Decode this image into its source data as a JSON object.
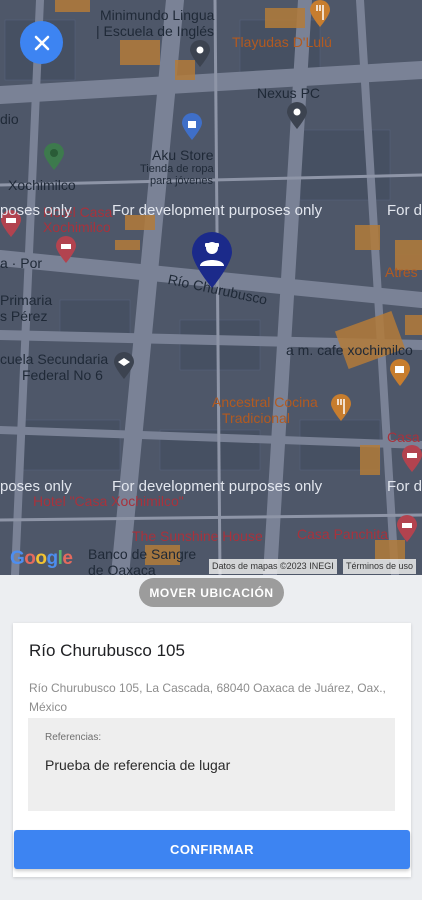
{
  "map": {
    "labels": {
      "minimundo": "Minimundo Lingua",
      "escuela_ingles": "| Escuela de Inglés",
      "tlayudas": "Tlayudas D'Lulú",
      "nexus": "Nexus PC",
      "dio": "dio",
      "aku": "Aku Store",
      "aku_sub_1": "Tienda de ropa",
      "aku_sub_2": "para jóvenes",
      "xochimilco": "Xochimilco",
      "hotel_casa_1": "Hotel Casa",
      "xochimilco_2": "Xochimilco",
      "rio_churubusco": "Río Churubusco",
      "atres": "Atres",
      "primaria": "Primaria",
      "s_perez": "s Pérez",
      "a_por": "a · Por",
      "secundaria_1": "cuela Secundaria",
      "secundaria_2": "Federal No 6",
      "cafe": "a m. cafe xochimilco",
      "ancestral_1": "Ancestral Cocina",
      "ancestral_2": "Tradicional",
      "casa": "Casa",
      "hotel_casa_2": "Hotel \"Casa Xochimilco\"",
      "sunshine": "The Sunshine House",
      "panchita": "Casa Panchita",
      "banco_1": "Banco de Sangre",
      "banco_2": "de Oaxaca"
    },
    "dev_text": {
      "center": "For development purposes only",
      "left": "poses only",
      "right": "For d"
    },
    "google_letters": [
      "G",
      "o",
      "o",
      "g",
      "l",
      "e"
    ],
    "attribution": {
      "data": "Datos de mapas ©2023 INEGI",
      "terms": "Términos de uso"
    },
    "close_icon": "close-icon",
    "pin_icon": "user-location-pin-icon",
    "colors": {
      "accent": "#3d84f2",
      "pin": "#1b2a8a"
    }
  },
  "move_button": "MOVER UBICACIÓN",
  "card": {
    "title": "Río Churubusco 105",
    "address": "Río Churubusco 105, La Cascada, 68040 Oaxaca de Juárez, Oax., México",
    "reference_label": "Referencias:",
    "reference_value": "Prueba de referencia de lugar"
  },
  "confirm_button": "CONFIRMAR"
}
